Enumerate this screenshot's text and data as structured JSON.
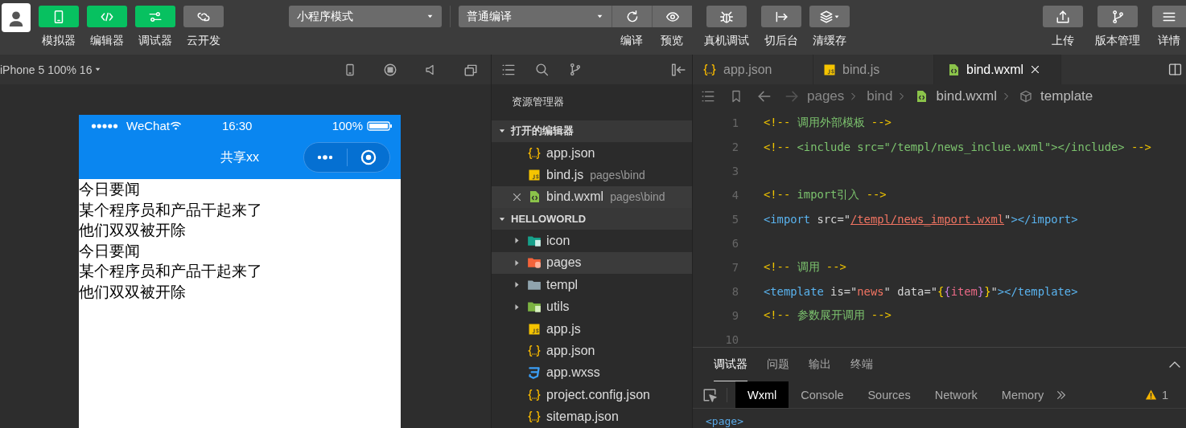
{
  "toolbar": {
    "modes": [
      {
        "label": "模拟器",
        "on": true
      },
      {
        "label": "编辑器",
        "on": true
      },
      {
        "label": "调试器",
        "on": true
      },
      {
        "label": "云开发",
        "on": false
      }
    ],
    "mode_select": "小程序模式",
    "compile_select": "普通编译",
    "actions": [
      {
        "label": "编译"
      },
      {
        "label": "预览"
      },
      {
        "label": "真机调试"
      },
      {
        "label": "切后台"
      },
      {
        "label": "清缓存"
      }
    ],
    "right_actions": [
      {
        "label": "上传"
      },
      {
        "label": "版本管理"
      },
      {
        "label": "详情"
      }
    ]
  },
  "simulator": {
    "device": "iPhone 5 100% 16",
    "status_bar": {
      "carrier": "WeChat",
      "time": "16:30",
      "battery": "100%"
    },
    "nav_title": "共享xx",
    "content_lines": [
      "今日要闻",
      "某个程序员和产品干起来了",
      "他们双双被开除",
      "今日要闻",
      "某个程序员和产品干起来了",
      "他们双双被开除"
    ]
  },
  "explorer": {
    "title": "资源管理器",
    "open_editors": {
      "title": "打开的编辑器",
      "expanded": true,
      "items": [
        {
          "name": "app.json",
          "kind": "json",
          "selected": false
        },
        {
          "name": "bind.js",
          "path": "pages\\bind",
          "kind": "js",
          "selected": false
        },
        {
          "name": "bind.wxml",
          "path": "pages\\bind",
          "kind": "wxml",
          "selected": true
        }
      ]
    },
    "project": {
      "title": "HELLOWORLD",
      "expanded": true,
      "items": [
        {
          "name": "icon",
          "kind": "folder",
          "color": "#16a08a",
          "expanded": false,
          "selected": false
        },
        {
          "name": "pages",
          "kind": "folder",
          "color": "#f4633a",
          "expanded": false,
          "selected": true
        },
        {
          "name": "templ",
          "kind": "folder",
          "color": "#90a4ae",
          "expanded": false,
          "selected": false
        },
        {
          "name": "utils",
          "kind": "folder",
          "color": "#7cb342",
          "expanded": false,
          "selected": false
        },
        {
          "name": "app.js",
          "kind": "js",
          "selected": false
        },
        {
          "name": "app.json",
          "kind": "json",
          "selected": false
        },
        {
          "name": "app.wxss",
          "kind": "wxss",
          "selected": false
        },
        {
          "name": "project.config.json",
          "kind": "json",
          "selected": false
        },
        {
          "name": "sitemap.json",
          "kind": "json",
          "selected": false
        }
      ]
    }
  },
  "editor": {
    "tabs": [
      {
        "name": "app.json",
        "kind": "json",
        "selected": false
      },
      {
        "name": "bind.js",
        "kind": "js",
        "selected": false
      },
      {
        "name": "bind.wxml",
        "kind": "wxml",
        "selected": true
      }
    ],
    "breadcrumb": [
      "pages",
      "bind",
      "bind.wxml",
      "template"
    ],
    "lines": [
      {
        "number": "1",
        "tokens": [
          {
            "text": "<!--",
            "kind": "mark"
          },
          {
            "text": " 调用外部模板 ",
            "kind": "comment"
          },
          {
            "text": "-->",
            "kind": "mark"
          }
        ]
      },
      {
        "number": "2",
        "tokens": [
          {
            "text": "<!--",
            "kind": "mark"
          },
          {
            "text": " <include src=\"/templ/news_inclue.wxml\"></include> ",
            "kind": "comment"
          },
          {
            "text": "-->",
            "kind": "mark"
          }
        ]
      },
      {
        "number": "3"
      },
      {
        "number": "4",
        "tokens": [
          {
            "text": "<!--",
            "kind": "mark"
          },
          {
            "text": " import引入 ",
            "kind": "comment"
          },
          {
            "text": "-->",
            "kind": "mark"
          }
        ]
      },
      {
        "number": "5",
        "tokens": [
          {
            "text": "<import",
            "kind": "tag"
          },
          {
            "text": " src=\"",
            "kind": "attr"
          },
          {
            "text": "/templ/news_import.wxml",
            "kind": "link"
          },
          {
            "text": "\"",
            "kind": "attr"
          },
          {
            "text": "></import>",
            "kind": "tag"
          }
        ]
      },
      {
        "number": "6"
      },
      {
        "number": "7",
        "tokens": [
          {
            "text": "<!--",
            "kind": "mark"
          },
          {
            "text": " 调用 ",
            "kind": "comment"
          },
          {
            "text": "-->",
            "kind": "mark"
          }
        ]
      },
      {
        "number": "8",
        "tokens": [
          {
            "text": "<template",
            "kind": "tag"
          },
          {
            "text": " is=\"",
            "kind": "attr"
          },
          {
            "text": "news",
            "kind": "string"
          },
          {
            "text": "\" data=\"",
            "kind": "attr"
          },
          {
            "text": "{",
            "kind": "brace"
          },
          {
            "text": "{",
            "kind": "brace2"
          },
          {
            "text": "item",
            "kind": "variable"
          },
          {
            "text": "}",
            "kind": "brace2"
          },
          {
            "text": "}",
            "kind": "brace"
          },
          {
            "text": "\"",
            "kind": "attr"
          },
          {
            "text": "></template>",
            "kind": "tag"
          }
        ]
      },
      {
        "number": "9",
        "tokens": [
          {
            "text": "<!--",
            "kind": "mark"
          },
          {
            "text": " 参数展开调用 ",
            "kind": "comment"
          },
          {
            "text": "-->",
            "kind": "mark"
          }
        ]
      },
      {
        "number": "10"
      }
    ]
  },
  "panel": {
    "tabs": [
      {
        "label": "调试器",
        "selected": true
      },
      {
        "label": "问题",
        "selected": false
      },
      {
        "label": "输出",
        "selected": false
      },
      {
        "label": "终端",
        "selected": false
      }
    ],
    "devtools_tabs": [
      {
        "label": "Wxml",
        "selected": true
      },
      {
        "label": "Console",
        "selected": false
      },
      {
        "label": "Sources",
        "selected": false
      },
      {
        "label": "Network",
        "selected": false
      },
      {
        "label": "Memory",
        "selected": false
      }
    ],
    "warnings": "1",
    "content": "<page>"
  }
}
